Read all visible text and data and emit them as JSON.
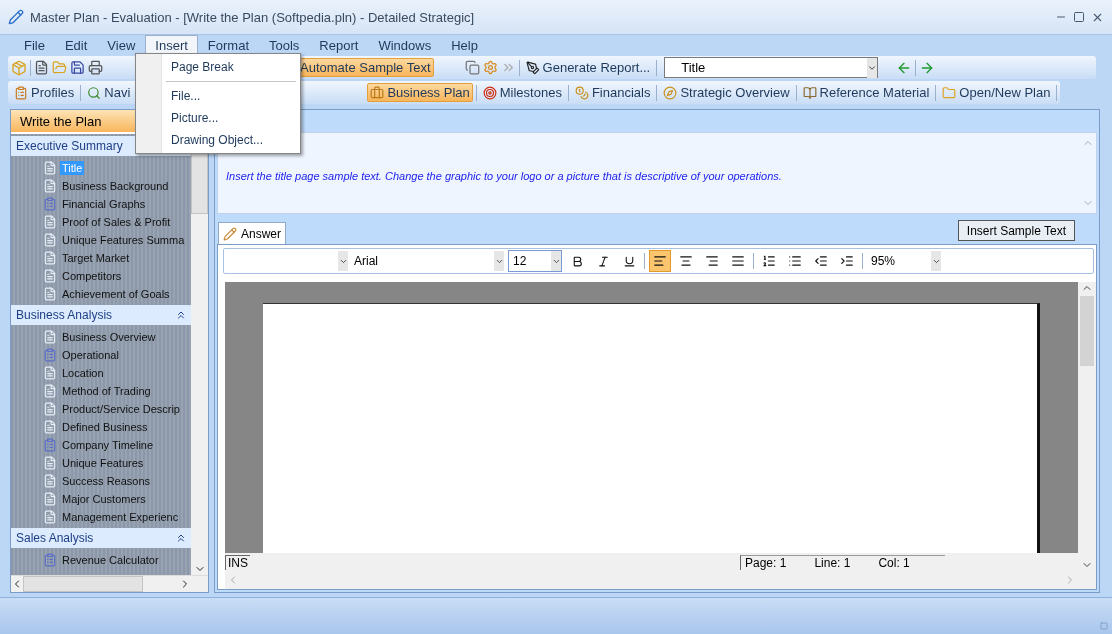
{
  "window": {
    "title": "Master Plan - Evaluation - [Write the Plan (Softpedia.pln) - Detailed Strategic]"
  },
  "menubar": [
    {
      "label": "File",
      "selected": false
    },
    {
      "label": "Edit",
      "selected": false
    },
    {
      "label": "View",
      "selected": false
    },
    {
      "label": "Insert",
      "selected": true
    },
    {
      "label": "Format",
      "selected": false
    },
    {
      "label": "Tools",
      "selected": false
    },
    {
      "label": "Report",
      "selected": false
    },
    {
      "label": "Windows",
      "selected": false
    },
    {
      "label": "Help",
      "selected": false
    }
  ],
  "insert_menu": [
    {
      "kind": "item",
      "label": "Page Break"
    },
    {
      "kind": "separator"
    },
    {
      "kind": "item",
      "label": "File..."
    },
    {
      "kind": "item",
      "label": "Picture..."
    },
    {
      "kind": "item",
      "label": "Drawing Object..."
    }
  ],
  "toolbar": {
    "automate_button": {
      "label": "Automate Sample Text",
      "active": true
    },
    "generate_button": {
      "label": "Generate Report..."
    },
    "section_select": {
      "value": "Title"
    }
  },
  "nav_toolbar": [
    {
      "label": "Profiles",
      "selected": false
    },
    {
      "label": "Navi",
      "selected": false
    },
    {
      "label": "Business Plan",
      "selected": true
    },
    {
      "label": "Milestones",
      "selected": false
    },
    {
      "label": "Financials",
      "selected": false
    },
    {
      "label": "Strategic Overview",
      "selected": false
    },
    {
      "label": "Reference Material",
      "selected": false
    },
    {
      "label": "Open/New Plan",
      "selected": false
    }
  ],
  "sidebar": {
    "title": "Write the Plan",
    "sections": [
      {
        "title": "Executive Summary",
        "toggle_shown": false,
        "items": [
          {
            "label": "Title",
            "kind": "page",
            "selected": true
          },
          {
            "label": "Business Background",
            "kind": "page",
            "selected": false
          },
          {
            "label": "Financial Graphs",
            "kind": "table",
            "selected": false
          },
          {
            "label": "Proof of Sales & Profit",
            "kind": "page",
            "selected": false
          },
          {
            "label": "Unique Features Summa",
            "kind": "page",
            "selected": false
          },
          {
            "label": "Target Market",
            "kind": "page",
            "selected": false
          },
          {
            "label": "Competitors",
            "kind": "page",
            "selected": false
          },
          {
            "label": "Achievement of Goals",
            "kind": "page",
            "selected": false
          }
        ]
      },
      {
        "title": "Business Analysis",
        "toggle_shown": true,
        "items": [
          {
            "label": "Business Overview",
            "kind": "page",
            "selected": false
          },
          {
            "label": "Operational",
            "kind": "table",
            "selected": false
          },
          {
            "label": "Location",
            "kind": "page",
            "selected": false
          },
          {
            "label": "Method of Trading",
            "kind": "page",
            "selected": false
          },
          {
            "label": "Product/Service Descrip",
            "kind": "page",
            "selected": false
          },
          {
            "label": "Defined Business",
            "kind": "page",
            "selected": false
          },
          {
            "label": "Company Timeline",
            "kind": "table",
            "selected": false
          },
          {
            "label": "Unique Features",
            "kind": "page",
            "selected": false
          },
          {
            "label": "Success Reasons",
            "kind": "page",
            "selected": false
          },
          {
            "label": "Major Customers",
            "kind": "page",
            "selected": false
          },
          {
            "label": "Management Experienc",
            "kind": "page",
            "selected": false
          }
        ]
      },
      {
        "title": "Sales Analysis",
        "toggle_shown": true,
        "items": [
          {
            "label": "Revenue Calculator",
            "kind": "table",
            "selected": false
          }
        ]
      }
    ]
  },
  "question": {
    "text": "Insert the title page sample text. Change the graphic to your logo or a picture that is descriptive of your operations."
  },
  "answer": {
    "tab": "Answer",
    "insert_button": "Insert Sample Text",
    "format_bar": {
      "font": "Arial",
      "size": "12",
      "zoom": "95%",
      "alignment": [
        {
          "selected": true
        },
        {
          "selected": false
        },
        {
          "selected": false
        },
        {
          "selected": false
        }
      ],
      "bold": false,
      "italic": false,
      "underline": false
    },
    "status": {
      "mode": "INS",
      "page": "Page: 1",
      "line": "Line: 1",
      "col": "Col: 1"
    }
  }
}
